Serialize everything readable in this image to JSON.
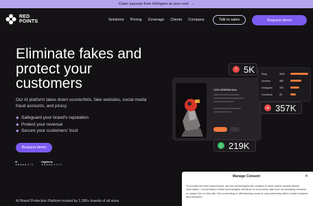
{
  "announcement": {
    "text": "Claim payouts from infringers at zero cost",
    "arrow": "→"
  },
  "brand": {
    "line1": "RED",
    "line2": "POINTS",
    "color": "#ffffff"
  },
  "nav": {
    "items": [
      "Solutions",
      "Pricing",
      "Coverage",
      "Clients",
      "Company"
    ],
    "talk_label": "Talk to sales",
    "demo_label": "Request demo"
  },
  "hero": {
    "title": "Eliminate fakes and protect your customers",
    "description": "Our AI platform takes down counterfeits, fake websites, social media fraud accounts, and piracy.",
    "bullets": [
      "Safeguard your brand's reputation",
      "Protect your revenue",
      "Secure your customers' trust"
    ],
    "cta": "Request demo"
  },
  "ratings": {
    "g2": {
      "label": "G",
      "score": "★★★★★ 5 / 5"
    },
    "capterra": {
      "label": "Capterra",
      "score": "★★★★★ 4.9 / 5"
    }
  },
  "trusted_text": "AI Brand Protection Platform trusted by 1,300+ brands of all sizes",
  "dashboard": {
    "product_title": "100% ARMENIA Moto",
    "stats": [
      {
        "value": "5K",
        "color": "#e84b4b",
        "icon": "alert-icon"
      },
      {
        "value": "357K",
        "color": "#e84b4b",
        "icon": "x-icon"
      },
      {
        "value": "219K",
        "color": "#3fbf6a",
        "icon": "check-icon"
      }
    ],
    "platforms": [
      {
        "name": "Ebay",
        "value": "2676",
        "fraction": 1.0,
        "color": "#ef7a3c"
      },
      {
        "name": "Amazon",
        "value": "463",
        "fraction": 0.62,
        "color": "#ef7a3c"
      },
      {
        "name": "Instagram",
        "value": "378",
        "fraction": 0.5,
        "color": "#ef7a3c"
      },
      {
        "name": "Facebook",
        "value": "25",
        "fraction": 0.3,
        "color": "#ef7a3c"
      }
    ]
  },
  "consent": {
    "title": "Manage Consent",
    "close": "✕",
    "text": "To provide the best experiences, we use technologies like cookies to store and/or access device information. Consenting to these technologies will allow us to process data such as browsing behavior or unique IDs on this site. Not consenting or withdrawing consent, may adversely affect certain features and functions."
  },
  "colors": {
    "accent": "#7b5cf0",
    "banner": "#b4a4ee",
    "background": "#131114"
  }
}
